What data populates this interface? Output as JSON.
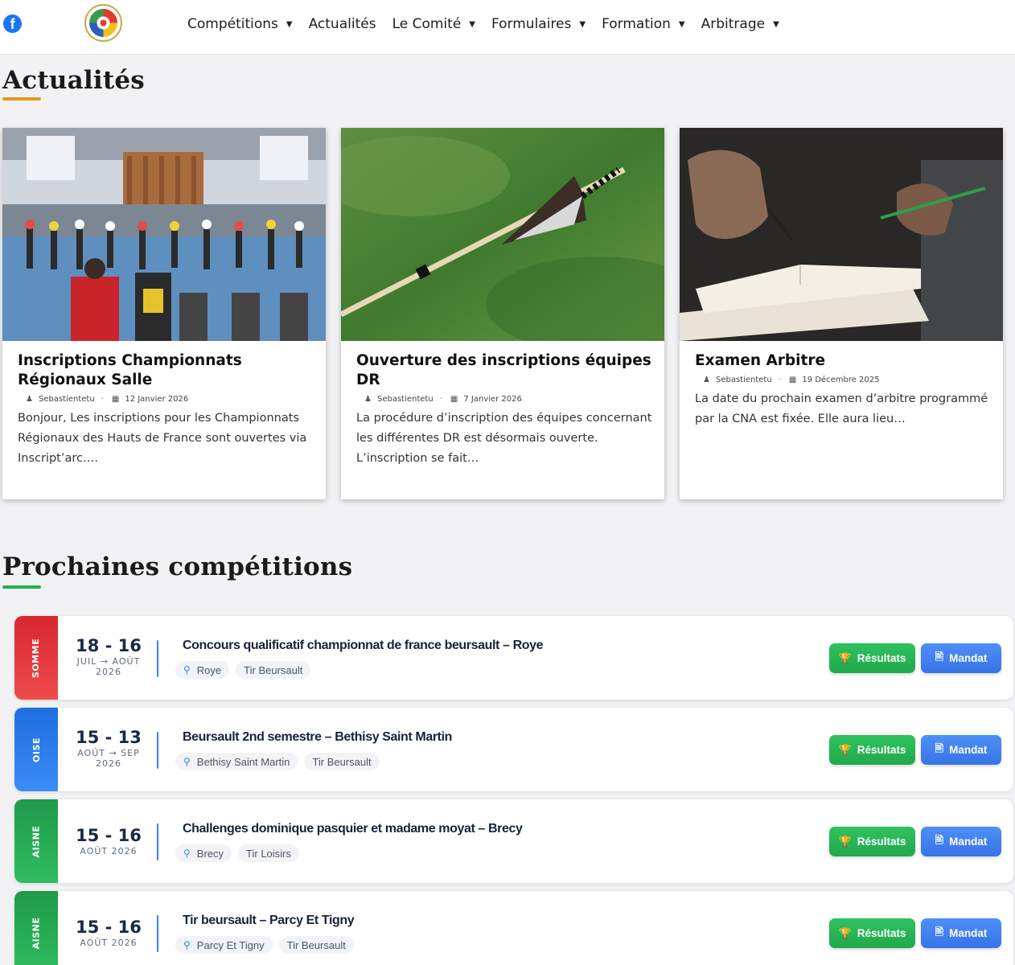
{
  "header": {
    "facebook_letter": "f",
    "nav": [
      {
        "label": "Compétitions",
        "caret": true
      },
      {
        "label": "Actualités",
        "caret": false
      },
      {
        "label": "Le Comité",
        "caret": true
      },
      {
        "label": "Formulaires",
        "caret": true
      },
      {
        "label": "Formation",
        "caret": true
      },
      {
        "label": "Arbitrage",
        "caret": true
      }
    ]
  },
  "news": {
    "heading": "Actualités",
    "accent": "#e7941f",
    "cards": [
      {
        "title": "Inscriptions Championnats Régionaux Salle",
        "author": "Sebastientetu",
        "date": "12 Janvier 2026",
        "excerpt": "Bonjour, Les inscriptions pour les Championnats Régionaux des Hauts de France sont ouvertes via Inscript’arc.…"
      },
      {
        "title": "Ouverture des inscriptions équipes DR",
        "author": "Sebastientetu",
        "date": "7 Janvier 2026",
        "excerpt": "La procédure d’inscription des équipes concernant les différentes DR est désormais ouverte. L’inscription se fait…"
      },
      {
        "title": "Examen Arbitre",
        "author": "Sebastientetu",
        "date": "19 Décembre 2025",
        "excerpt": "La date du prochain examen d’arbitre programmé par la CNA est fixée. Elle aura lieu…"
      }
    ]
  },
  "competitions": {
    "heading": "Prochaines compétitions",
    "accent": "#22b14c",
    "results_label": "Résultats",
    "mandat_label": "Mandat",
    "items": [
      {
        "dept": "SOMME",
        "dept_color_top": "#d7282f",
        "dept_color_bottom": "#ee4b4b",
        "days": "18 - 16",
        "month": "JUIL → AOÛT",
        "year": "2026",
        "title": "Concours qualificatif championnat de france beursault – Roye",
        "location": "Roye",
        "type": "Tir Beursault"
      },
      {
        "dept": "OISE",
        "dept_color_top": "#1e6fe0",
        "dept_color_bottom": "#3b8cf5",
        "days": "15 - 13",
        "month": "AOÛT → SEP",
        "year": "2026",
        "title": "Beursault 2nd semestre – Bethisy Saint Martin",
        "location": "Bethisy Saint Martin",
        "type": "Tir Beursault"
      },
      {
        "dept": "AISNE",
        "dept_color_top": "#1f9a4a",
        "dept_color_bottom": "#2fbd5e",
        "days": "15 - 16",
        "month": "AOÛT 2026",
        "year": "",
        "title": "Challenges dominique pasquier et madame moyat – Brecy",
        "location": "Brecy",
        "type": "Tir Loisirs"
      },
      {
        "dept": "AISNE",
        "dept_color_top": "#1f9a4a",
        "dept_color_bottom": "#2fbd5e",
        "days": "15 - 16",
        "month": "AOÛT 2026",
        "year": "",
        "title": "Tir beursault – Parcy Et Tigny",
        "location": "Parcy Et Tigny",
        "type": "Tir Beursault"
      }
    ]
  }
}
